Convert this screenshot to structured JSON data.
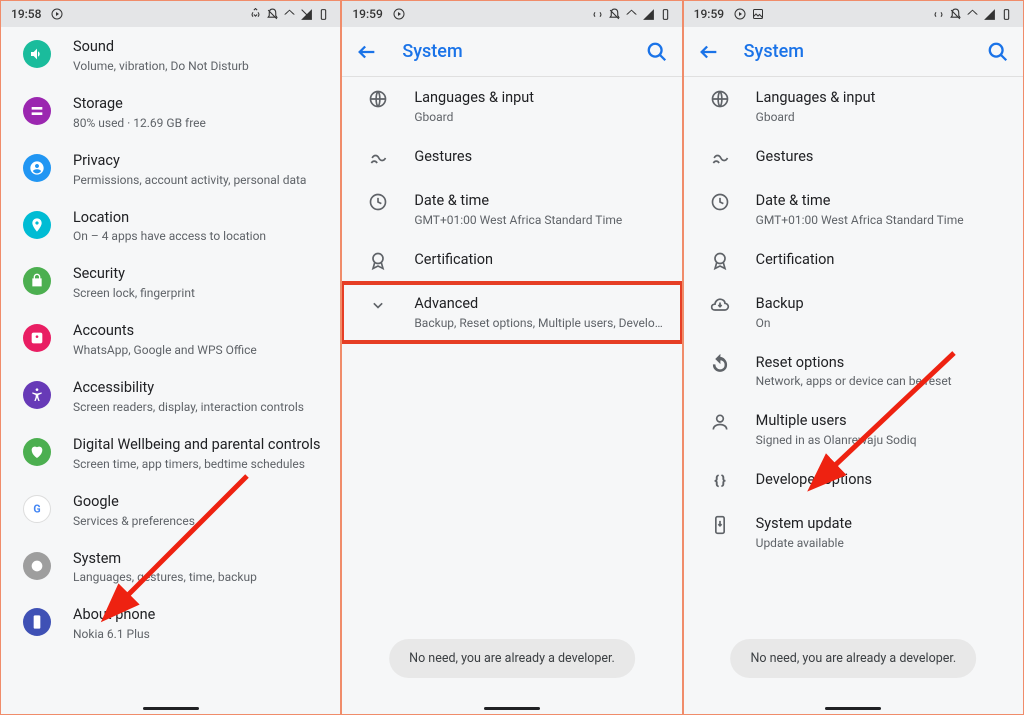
{
  "panel1": {
    "time": "19:58",
    "items": [
      {
        "title": "Sound",
        "sub": "Volume, vibration, Do Not Disturb",
        "color": "#1abc9c",
        "icon": "sound"
      },
      {
        "title": "Storage",
        "sub": "80% used · 12.69 GB free",
        "color": "#9b27b0",
        "icon": "storage"
      },
      {
        "title": "Privacy",
        "sub": "Permissions, account activity, personal data",
        "color": "#2196f3",
        "icon": "privacy"
      },
      {
        "title": "Location",
        "sub": "On – 4 apps have access to location",
        "color": "#00bcd4",
        "icon": "location"
      },
      {
        "title": "Security",
        "sub": "Screen lock, fingerprint",
        "color": "#4caf50",
        "icon": "security"
      },
      {
        "title": "Accounts",
        "sub": "WhatsApp, Google and WPS Office",
        "color": "#e91e63",
        "icon": "accounts"
      },
      {
        "title": "Accessibility",
        "sub": "Screen readers, display, interaction controls",
        "color": "#673ab7",
        "icon": "accessibility"
      },
      {
        "title": "Digital Wellbeing and parental controls",
        "sub": "Screen time, app timers, bedtime schedules",
        "color": "#4caf50",
        "icon": "wellbeing"
      },
      {
        "title": "Google",
        "sub": "Services & preferences",
        "color": "#ffffff",
        "icon": "google"
      },
      {
        "title": "System",
        "sub": "Languages, gestures, time, backup",
        "color": "#9e9e9e",
        "icon": "system"
      },
      {
        "title": "About phone",
        "sub": "Nokia 6.1 Plus",
        "color": "#3f51b5",
        "icon": "about"
      }
    ]
  },
  "panel2": {
    "time": "19:59",
    "title": "System",
    "items": [
      {
        "title": "Languages & input",
        "sub": "Gboard",
        "icon": "globe"
      },
      {
        "title": "Gestures",
        "sub": "",
        "icon": "gestures"
      },
      {
        "title": "Date & time",
        "sub": "GMT+01:00 West Africa Standard Time",
        "icon": "clock"
      },
      {
        "title": "Certification",
        "sub": "",
        "icon": "badge"
      },
      {
        "title": "Advanced",
        "sub": "Backup, Reset options, Multiple users, Developer o..",
        "icon": "chevron"
      }
    ],
    "toast": "No need, you are already a developer."
  },
  "panel3": {
    "time": "19:59",
    "title": "System",
    "items": [
      {
        "title": "Languages & input",
        "sub": "Gboard",
        "icon": "globe"
      },
      {
        "title": "Gestures",
        "sub": "",
        "icon": "gestures"
      },
      {
        "title": "Date & time",
        "sub": "GMT+01:00 West Africa Standard Time",
        "icon": "clock"
      },
      {
        "title": "Certification",
        "sub": "",
        "icon": "badge"
      },
      {
        "title": "Backup",
        "sub": "On",
        "icon": "cloud"
      },
      {
        "title": "Reset options",
        "sub": "Network, apps or device can be reset",
        "icon": "reset"
      },
      {
        "title": "Multiple users",
        "sub": "Signed in as Olanrewaju Sodiq",
        "icon": "user"
      },
      {
        "title": "Developer options",
        "sub": "",
        "icon": "braces"
      },
      {
        "title": "System update",
        "sub": "Update available",
        "icon": "update"
      }
    ],
    "toast": "No need, you are already a developer."
  }
}
